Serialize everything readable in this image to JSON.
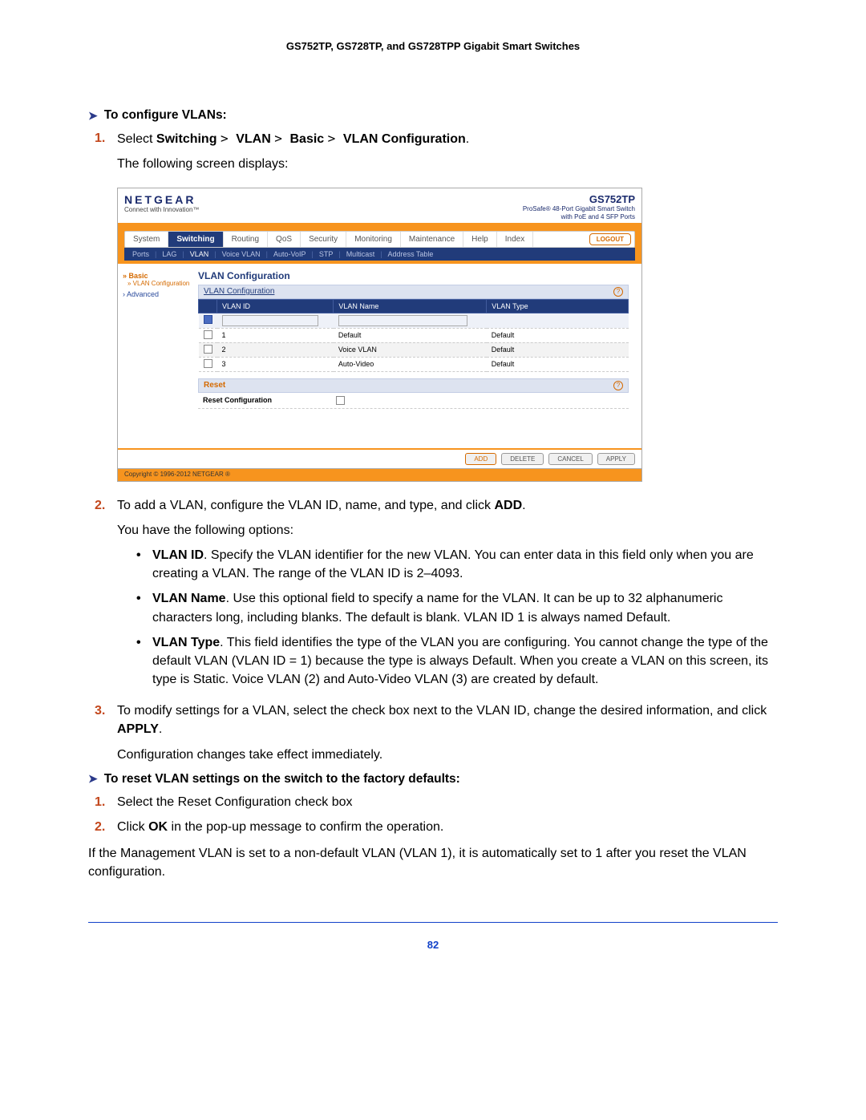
{
  "doc": {
    "header": "GS752TP, GS728TP, and GS728TPP Gigabit Smart Switches",
    "page_number": "82"
  },
  "section1": {
    "title": "To configure VLANs:",
    "step1_a": "Select ",
    "step1_b": "Switching",
    "step1_c": "VLAN",
    "step1_d": "Basic",
    "step1_e": "VLAN Configuration",
    "step1_note": "The following screen displays:",
    "step2_a": "To add a VLAN, configure the VLAN ID, name, and type, and click ",
    "step2_b": "ADD",
    "step2_note": "You have the following options:",
    "bullet1_title": "VLAN ID",
    "bullet1_text": ". Specify the VLAN identifier for the new VLAN. You can enter data in this field only when you are creating a VLAN. The range of the VLAN ID is 2–4093.",
    "bullet2_title": "VLAN Name",
    "bullet2_text": ". Use this optional field to specify a name for the VLAN. It can be up to 32 alphanumeric characters long, including blanks. The default is blank. VLAN ID 1 is always named Default.",
    "bullet3_title": "VLAN Type",
    "bullet3_text": ". This field identifies the type of the VLAN you are configuring. You cannot change the type of the default VLAN (VLAN ID = 1) because the type is always Default. When you create a VLAN on this screen, its type is Static. Voice VLAN (2) and Auto-Video VLAN (3) are created by default.",
    "step3_a": "To modify settings for a VLAN, select the check box next to the VLAN ID, change the desired information, and click ",
    "step3_b": "APPLY",
    "step3_note": "Configuration changes take effect immediately."
  },
  "section2": {
    "title": "To reset VLAN settings on the switch to the factory defaults:",
    "step1": "Select the Reset Configuration check box",
    "step2_a": "Click ",
    "step2_b": "OK",
    "step2_c": " in the pop-up message to confirm the operation.",
    "note": "If the Management VLAN is set to a non-default VLAN (VLAN 1), it is automatically set to 1 after you reset the VLAN configuration."
  },
  "shot": {
    "brand": "NETGEAR",
    "brand_sub": "Connect with Innovation™",
    "model": "GS752TP",
    "model_sub1": "ProSafe® 48-Port Gigabit Smart Switch",
    "model_sub2": "with PoE and 4 SFP Ports",
    "tabs": [
      "System",
      "Switching",
      "Routing",
      "QoS",
      "Security",
      "Monitoring",
      "Maintenance",
      "Help",
      "Index"
    ],
    "logout": "LOGOUT",
    "subnav": [
      "Ports",
      "LAG",
      "VLAN",
      "Voice VLAN",
      "Auto-VoIP",
      "STP",
      "Multicast",
      "Address Table"
    ],
    "leftnav_basic": "Basic",
    "leftnav_vlan": "VLAN Configuration",
    "leftnav_adv": "Advanced",
    "panel_title": "VLAN Configuration",
    "subpanel_title": "VLAN Configuration",
    "cols": {
      "id": "VLAN ID",
      "name": "VLAN Name",
      "type": "VLAN Type"
    },
    "rows": [
      {
        "id": "1",
        "name": "Default",
        "type": "Default"
      },
      {
        "id": "2",
        "name": "Voice VLAN",
        "type": "Default"
      },
      {
        "id": "3",
        "name": "Auto-Video",
        "type": "Default"
      }
    ],
    "reset_title": "Reset",
    "reset_label": "Reset Configuration",
    "buttons": {
      "add": "ADD",
      "delete": "DELETE",
      "cancel": "CANCEL",
      "apply": "APPLY"
    },
    "copyright": "Copyright © 1996-2012 NETGEAR ®"
  }
}
